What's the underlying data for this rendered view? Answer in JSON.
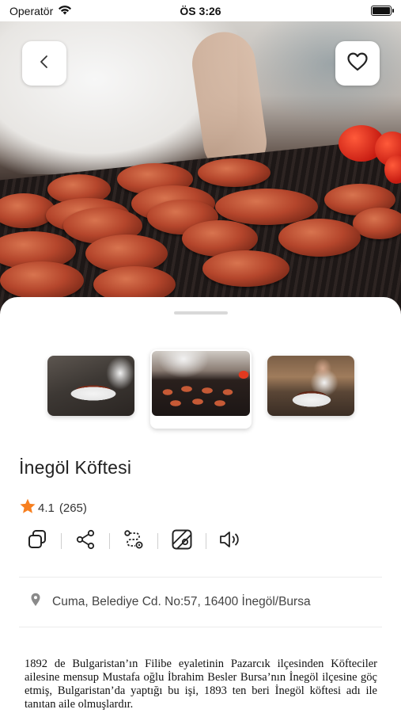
{
  "status_bar": {
    "carrier": "Operatör",
    "time": "ÖS 3:26"
  },
  "hero": {
    "back_icon": "chevron-left-icon",
    "favorite_icon": "heart-icon"
  },
  "thumbnails": [
    {
      "name": "thumbnail-plate-hand"
    },
    {
      "name": "thumbnail-grill",
      "selected": true
    },
    {
      "name": "thumbnail-chef-plate"
    }
  ],
  "place": {
    "title": "İnegöl Köftesi",
    "rating": "4.1",
    "review_count": "(265)",
    "rating_color": "#f77f1f"
  },
  "actions": [
    {
      "name": "copy-icon"
    },
    {
      "name": "share-icon"
    },
    {
      "name": "route-icon"
    },
    {
      "name": "map-icon"
    },
    {
      "name": "speaker-icon"
    }
  ],
  "address": {
    "text": "Cuma, Belediye Cd. No:57, 16400 İnegöl/Bursa"
  },
  "description": "1892 de Bulgaristan’ın Filibe eyaletinin Pazarcık ilçesinden Köfteciler ailesine mensup Mustafa oğlu İbrahim Besler Bursa’nın İnegöl ilçesine göç etmiş, Bulgaristan’da yaptığı bu işi, 1893 ten beri İnegöl köftesi adı ile tanıtan aile olmuşlardır."
}
